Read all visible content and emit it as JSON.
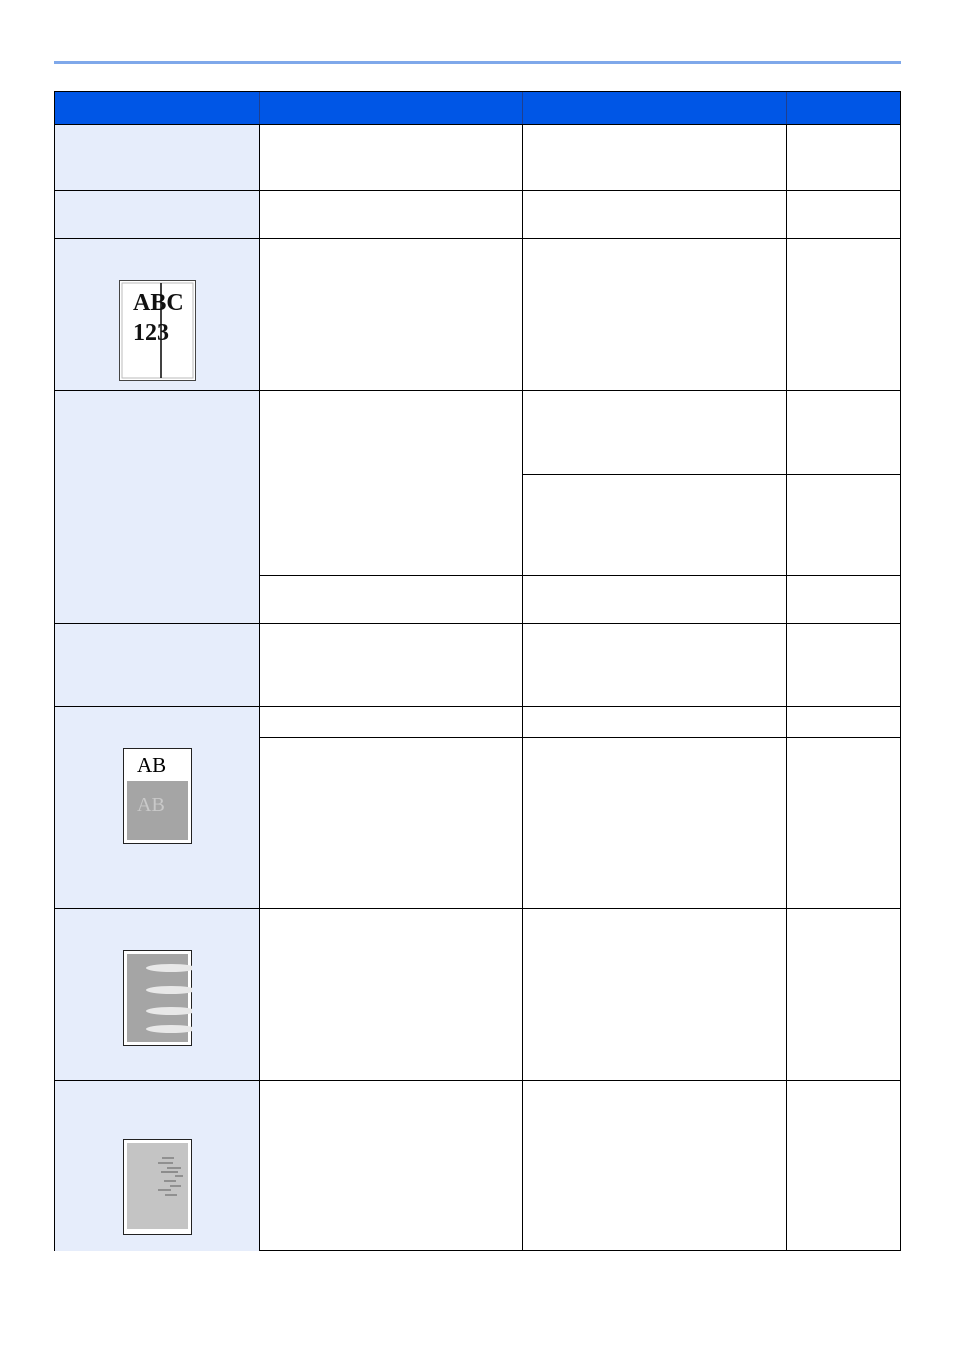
{
  "document": {
    "thumbnails": {
      "vertical_line": {
        "line1": "ABC",
        "line2": "123"
      },
      "ghost_image": {
        "top_text": "AB",
        "ghost_text": "AB"
      }
    },
    "colors": {
      "header_blue": "#0056e6",
      "label_column_tint": "#e6edfb",
      "top_rule": "#7fa8ea"
    }
  }
}
